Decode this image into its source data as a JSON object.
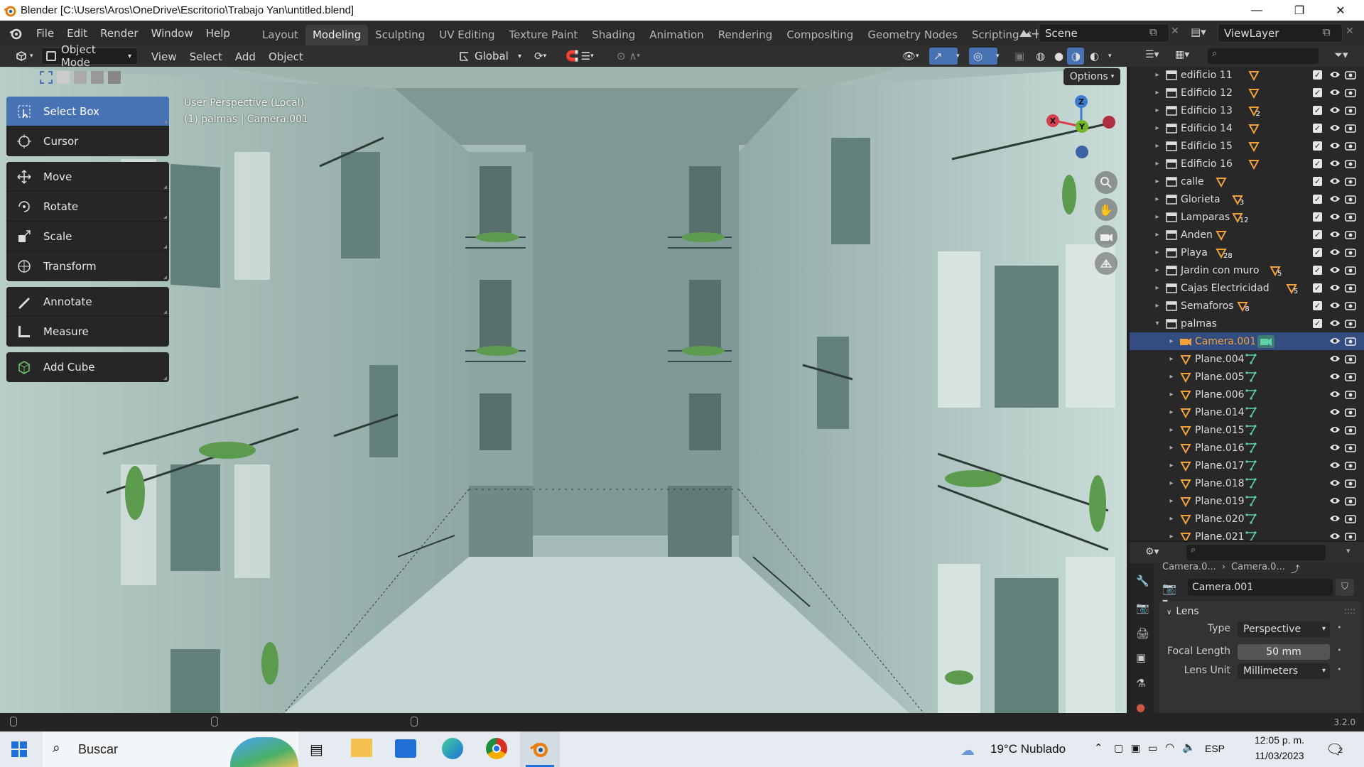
{
  "window": {
    "title": "Blender [C:\\Users\\Aros\\OneDrive\\Escritorio\\Trabajo Yan\\untitled.blend]",
    "controls": {
      "minimize": "—",
      "maximize": "❐",
      "close": "✕"
    }
  },
  "menus": [
    "File",
    "Edit",
    "Render",
    "Window",
    "Help"
  ],
  "workspaces": [
    "Layout",
    "Modeling",
    "Sculpting",
    "UV Editing",
    "Texture Paint",
    "Shading",
    "Animation",
    "Rendering",
    "Compositing",
    "Geometry Nodes",
    "Scripting"
  ],
  "active_workspace": "Modeling",
  "scene": {
    "name": "Scene",
    "view_layer": "ViewLayer"
  },
  "viewport_header": {
    "mode": "Object Mode",
    "menus": [
      "View",
      "Select",
      "Add",
      "Object"
    ],
    "orientation": "Global",
    "options_label": "Options"
  },
  "viewport": {
    "info_line1": "User Perspective (Local)",
    "info_line2": "(1) palmas | Camera.001",
    "gizmo": {
      "x": "X",
      "y": "Y",
      "z": "Z"
    }
  },
  "tools": [
    {
      "label": "Select Box",
      "icon": "select-box-icon",
      "selected": true
    },
    {
      "label": "Cursor",
      "icon": "cursor-icon"
    },
    {
      "label": "Move",
      "icon": "move-icon"
    },
    {
      "label": "Rotate",
      "icon": "rotate-icon"
    },
    {
      "label": "Scale",
      "icon": "scale-icon"
    },
    {
      "label": "Transform",
      "icon": "transform-icon"
    },
    {
      "label": "Annotate",
      "icon": "annotate-icon"
    },
    {
      "label": "Measure",
      "icon": "measure-icon"
    },
    {
      "label": "Add Cube",
      "icon": "add-cube-icon"
    }
  ],
  "outliner": {
    "rows": [
      {
        "name": "edificio 11",
        "type": "collection",
        "count": ""
      },
      {
        "name": "Edificio 12",
        "type": "collection",
        "count": ""
      },
      {
        "name": "Edificio 13",
        "type": "collection",
        "count": "2"
      },
      {
        "name": "Edificio 14",
        "type": "collection",
        "count": ""
      },
      {
        "name": "Edificio 15",
        "type": "collection",
        "count": ""
      },
      {
        "name": "Edificio 16",
        "type": "collection",
        "count": ""
      },
      {
        "name": "calle",
        "type": "collection",
        "count": ""
      },
      {
        "name": "Glorieta",
        "type": "collection",
        "count": "3"
      },
      {
        "name": "Lamparas",
        "type": "collection",
        "count": "12"
      },
      {
        "name": "Anden",
        "type": "collection",
        "count": ""
      },
      {
        "name": "Playa",
        "type": "collection",
        "count": "28"
      },
      {
        "name": "Jardin con muro",
        "type": "collection",
        "count": "5"
      },
      {
        "name": "Cajas Electricidad",
        "type": "collection",
        "count": "5"
      },
      {
        "name": "Semaforos",
        "type": "collection",
        "count": "8"
      },
      {
        "name": "palmas",
        "type": "collection-open",
        "count": ""
      },
      {
        "name": "Camera.001",
        "type": "camera",
        "count": ""
      },
      {
        "name": "Plane.004",
        "type": "mesh",
        "count": ""
      },
      {
        "name": "Plane.005",
        "type": "mesh",
        "count": ""
      },
      {
        "name": "Plane.006",
        "type": "mesh",
        "count": ""
      },
      {
        "name": "Plane.014",
        "type": "mesh",
        "count": ""
      },
      {
        "name": "Plane.015",
        "type": "mesh",
        "count": ""
      },
      {
        "name": "Plane.016",
        "type": "mesh",
        "count": ""
      },
      {
        "name": "Plane.017",
        "type": "mesh",
        "count": ""
      },
      {
        "name": "Plane.018",
        "type": "mesh",
        "count": ""
      },
      {
        "name": "Plane.019",
        "type": "mesh",
        "count": ""
      },
      {
        "name": "Plane.020",
        "type": "mesh",
        "count": ""
      },
      {
        "name": "Plane.021",
        "type": "mesh",
        "count": ""
      }
    ]
  },
  "properties": {
    "breadcrumb": [
      "Camera.0...",
      "Camera.0..."
    ],
    "datablock": "Camera.001",
    "panel": "Lens",
    "type_label": "Type",
    "type_value": "Perspective",
    "focal_label": "Focal Length",
    "focal_value": "50 mm",
    "unit_label": "Lens Unit",
    "unit_value": "Millimeters"
  },
  "status": {
    "version": "3.2.0"
  },
  "taskbar": {
    "search": "Buscar",
    "weather": "19°C Nublado",
    "lang": "ESP",
    "time": "12:05 p. m.",
    "date": "11/03/2023",
    "notif_count": "2"
  }
}
